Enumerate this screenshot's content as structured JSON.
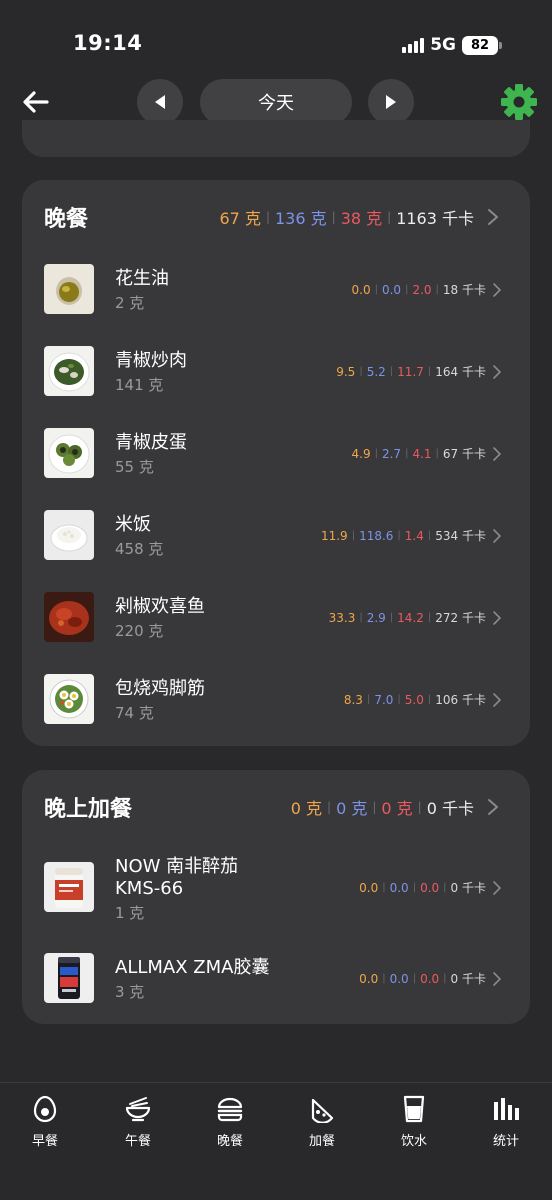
{
  "status_bar": {
    "time": "19:14",
    "network": "5G",
    "battery": "82"
  },
  "nav": {
    "date_label": "今天"
  },
  "dinner": {
    "title": "晚餐",
    "carb": "67 克",
    "protein": "136 克",
    "fat": "38 克",
    "kcal": "1163 千卡",
    "items": [
      {
        "name": "花生油",
        "qty": "2 克",
        "carb": "0.0",
        "protein": "0.0",
        "fat": "2.0",
        "kcal": "18 千卡"
      },
      {
        "name": "青椒炒肉",
        "qty": "141 克",
        "carb": "9.5",
        "protein": "5.2",
        "fat": "11.7",
        "kcal": "164 千卡"
      },
      {
        "name": "青椒皮蛋",
        "qty": "55 克",
        "carb": "4.9",
        "protein": "2.7",
        "fat": "4.1",
        "kcal": "67 千卡"
      },
      {
        "name": "米饭",
        "qty": "458 克",
        "carb": "11.9",
        "protein": "118.6",
        "fat": "1.4",
        "kcal": "534 千卡"
      },
      {
        "name": "剁椒欢喜鱼",
        "qty": "220 克",
        "carb": "33.3",
        "protein": "2.9",
        "fat": "14.2",
        "kcal": "272 千卡"
      },
      {
        "name": "包烧鸡脚筋",
        "qty": "74 克",
        "carb": "8.3",
        "protein": "7.0",
        "fat": "5.0",
        "kcal": "106 千卡"
      }
    ]
  },
  "snack": {
    "title": "晚上加餐",
    "carb": "0 克",
    "protein": "0 克",
    "fat": "0 克",
    "kcal": "0 千卡",
    "items": [
      {
        "name_line1": "NOW 南非醉茄",
        "name_line2": "KMS-66",
        "qty": "1 克",
        "carb": "0.0",
        "protein": "0.0",
        "fat": "0.0",
        "kcal": "0 千卡"
      },
      {
        "name": "ALLMAX ZMA胶囊",
        "qty": "3 克",
        "carb": "0.0",
        "protein": "0.0",
        "fat": "0.0",
        "kcal": "0 千卡"
      }
    ]
  },
  "tabs": [
    {
      "label": "早餐",
      "icon": "egg-icon"
    },
    {
      "label": "午餐",
      "icon": "bowl-icon"
    },
    {
      "label": "晚餐",
      "icon": "burger-icon"
    },
    {
      "label": "加餐",
      "icon": "pizza-slice-icon"
    },
    {
      "label": "饮水",
      "icon": "glass-icon"
    },
    {
      "label": "统计",
      "icon": "bar-chart-icon"
    }
  ],
  "colors": {
    "carb": "#f0a64a",
    "protein": "#7b93e8",
    "fat": "#e85a5e",
    "settings": "#3fb54f"
  }
}
